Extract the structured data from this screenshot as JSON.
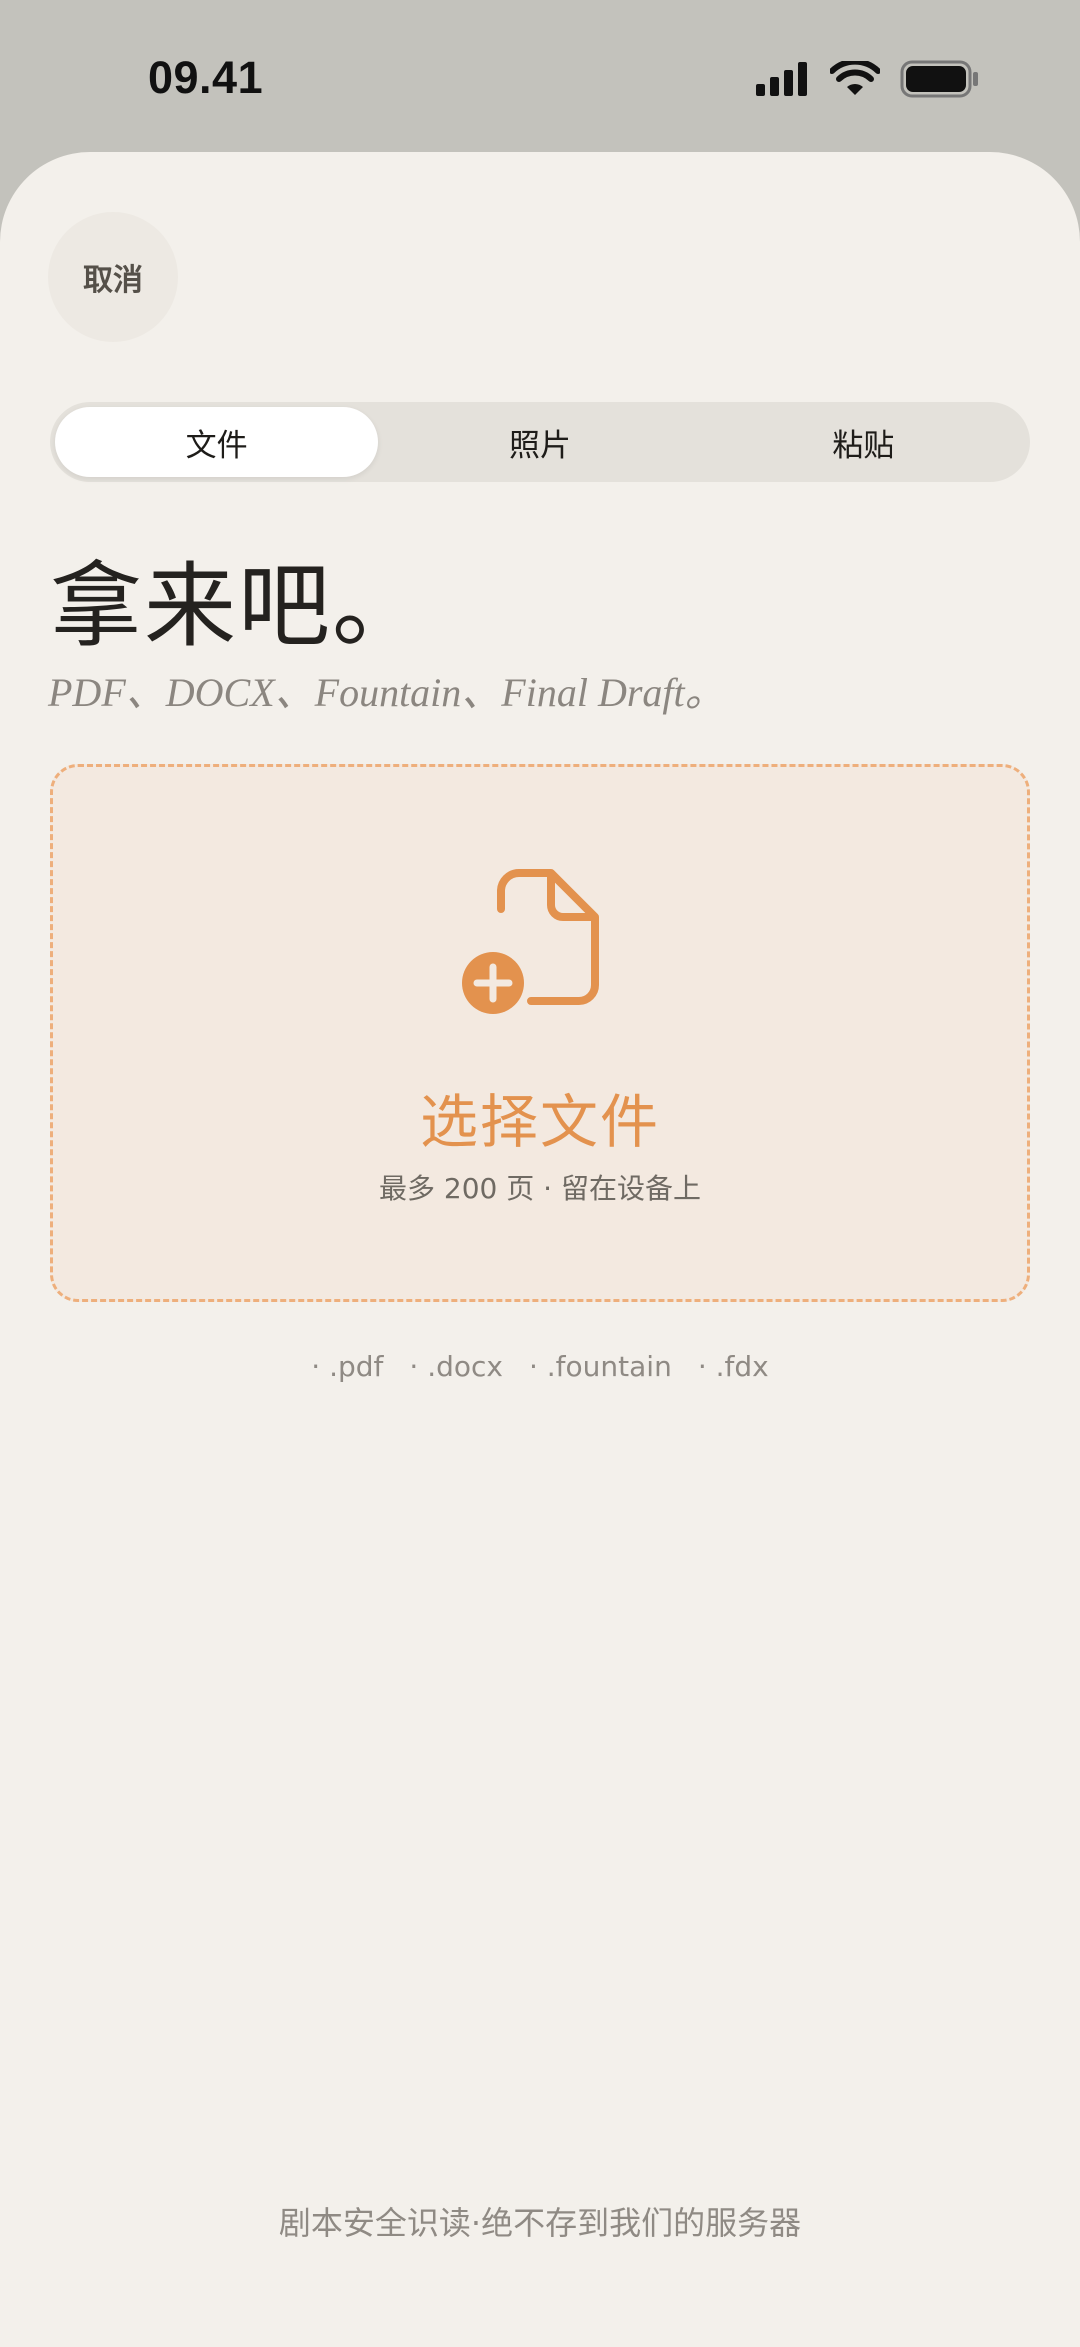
{
  "status_bar": {
    "time": "09.41",
    "icons": [
      "cellular-signal-icon",
      "wifi-icon",
      "battery-icon"
    ]
  },
  "header": {
    "cancel_label": "取消"
  },
  "tabs": [
    {
      "label": "文件",
      "active": true
    },
    {
      "label": "照片",
      "active": false
    },
    {
      "label": "粘贴",
      "active": false
    }
  ],
  "main": {
    "title": "拿来吧。",
    "subtitle": "PDF、DOCX、Fountain、Final Draft。"
  },
  "dropzone": {
    "icon": "file-add-icon",
    "title": "选择文件",
    "subtitle": "最多 200 页 · 留在设备上"
  },
  "formats": [
    "· .pdf",
    "· .docx",
    "· .fountain",
    "· .fdx"
  ],
  "footer": {
    "note": "剧本安全识读·绝不存到我们的服务器"
  },
  "colors": {
    "accent": "#e3924e",
    "background": "#f3f0eb",
    "dropzone_bg": "#f3e9e0",
    "dropzone_border": "#eeaf7c"
  }
}
